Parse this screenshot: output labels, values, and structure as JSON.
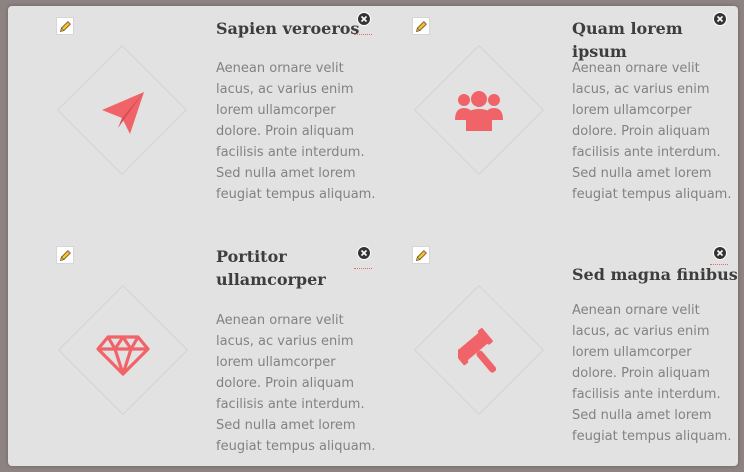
{
  "features": [
    {
      "title": "Sapien veroeros",
      "body": "Aenean ornare velit\nlacus, ac varius enim\nlorem ullamcorper\ndolore. Proin aliquam\nfacilisis ante interdum.\nSed nulla amet lorem\nfeugiat tempus aliquam.",
      "icon": "paper-plane-icon"
    },
    {
      "title": "Quam lorem ipsum",
      "body": "Aenean ornare velit\nlacus, ac varius enim\nlorem ullamcorper\ndolore. Proin aliquam\nfacilisis ante interdum.\nSed nulla amet lorem\nfeugiat tempus aliquam.",
      "icon": "users-icon"
    },
    {
      "title": "Portitor ullamcorper",
      "body": "Aenean ornare velit\nlacus, ac varius enim\nlorem ullamcorper\ndolore. Proin aliquam\nfacilisis ante interdum.\nSed nulla amet lorem\nfeugiat tempus aliquam.",
      "icon": "diamond-icon"
    },
    {
      "title": "Sed magna finibus",
      "body": "Aenean ornare velit\nlacus, ac varius enim\nlorem ullamcorper\ndolore. Proin aliquam\nfacilisis ante interdum.\nSed nulla amet lorem\nfeugiat tempus aliquam.",
      "icon": "gavel-icon"
    }
  ],
  "colors": {
    "accent": "#f06469",
    "backdrop": "#8e8383",
    "panel": "#e2e2e2",
    "title": "#3d3d3d",
    "body": "#828282"
  }
}
